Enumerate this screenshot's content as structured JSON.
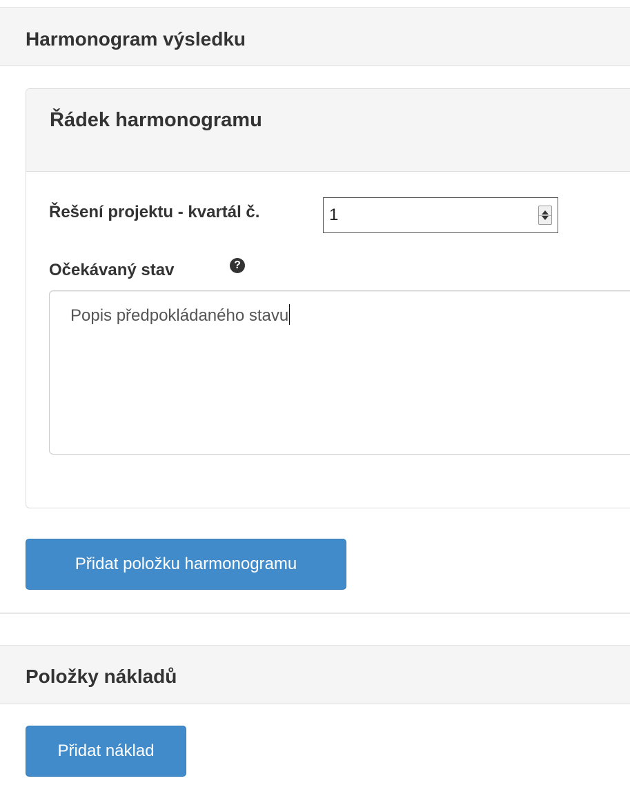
{
  "harmonogram_section": {
    "title": "Harmonogram výsledku"
  },
  "harmonogram_row_panel": {
    "title": "Řádek harmonogramu",
    "quarter_field": {
      "label": "Řešení projektu - kvartál č.",
      "value": "1"
    },
    "expected_state_field": {
      "label": "Očekávaný stav",
      "help_icon": "question-circle-icon",
      "value": "Popis předpokládaného stavu"
    }
  },
  "add_harmonogram_button": {
    "label": "Přidat položku harmonogramu"
  },
  "costs_section": {
    "title": "Položky nákladů"
  },
  "add_cost_button": {
    "label": "Přidat náklad"
  },
  "colors": {
    "primary_button": "#428bca",
    "header_background": "#f5f5f5",
    "border": "#dddddd",
    "text": "#333333"
  }
}
